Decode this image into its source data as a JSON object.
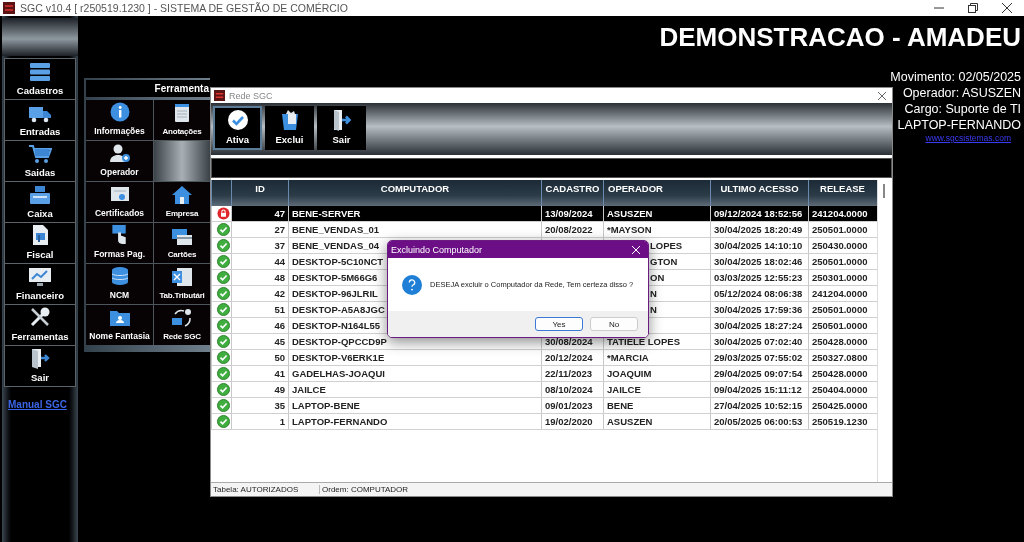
{
  "window": {
    "title": "SGC v10.4 [ r250519.1230 ] - SISTEMA DE GESTÃO DE COMÉRCIO"
  },
  "sidebar": {
    "items": [
      {
        "label": "Cadastros"
      },
      {
        "label": "Entradas"
      },
      {
        "label": "Saidas"
      },
      {
        "label": "Caixa"
      },
      {
        "label": "Fiscal"
      },
      {
        "label": "Financeiro"
      },
      {
        "label": "Ferramentas"
      },
      {
        "label": "Sair"
      }
    ],
    "link": "Manual SGC"
  },
  "header": {
    "title": "DEMONSTRACAO - AMADEU",
    "lines": [
      "Movimento: 02/05/2025",
      "Operador: ASUSZEN",
      "Cargo: Suporte de TI",
      "LAPTOP-FERNANDO"
    ],
    "link": "www.sgcsistemas.com"
  },
  "tools_panel": {
    "title": "Ferramenta",
    "items": [
      {
        "kind": "tool",
        "label": "Informações"
      },
      {
        "kind": "tool",
        "label": "Anotações"
      },
      {
        "kind": "tool",
        "label": "Operador"
      },
      {
        "kind": "blank"
      },
      {
        "kind": "tool",
        "label": "Certificados"
      },
      {
        "kind": "tool",
        "label": "Empresa"
      },
      {
        "kind": "tool",
        "label": "Formas Pag."
      },
      {
        "kind": "tool",
        "label": "Cartões"
      },
      {
        "kind": "tool",
        "label": "NCM"
      },
      {
        "kind": "tool",
        "label": "Tab.Tributári"
      },
      {
        "kind": "tool",
        "label": "Nome Fantasia"
      },
      {
        "kind": "tool",
        "label": "Rede SGC"
      }
    ]
  },
  "rede_window": {
    "title": "Rede SGC",
    "toolbar": [
      {
        "label": "Ativa",
        "selected": true
      },
      {
        "label": "Exclui",
        "selected": false
      },
      {
        "label": "Sair",
        "selected": false
      }
    ],
    "table": {
      "columns": [
        "ID",
        "COMPUTADOR",
        "CADASTRO",
        "OPERADOR",
        "ULTIMO ACESSO",
        "RELEASE"
      ],
      "rows": [
        {
          "locked": true,
          "selected": true,
          "covered": false,
          "id": "47",
          "computador": "BENE-SERVER",
          "cadastro": "13/09/2024",
          "operador": "ASUSZEN",
          "ultimo_acesso": "09/12/2024 18:52:56",
          "release": "241204.0000"
        },
        {
          "locked": false,
          "selected": false,
          "covered": false,
          "id": "27",
          "computador": "BENE_VENDAS_01",
          "cadastro": "20/08/2022",
          "operador": "*MAYSON",
          "ultimo_acesso": "30/04/2025 18:20:49",
          "release": "250501.0000"
        },
        {
          "locked": false,
          "selected": false,
          "covered": true,
          "id": "37",
          "computador": "BENE_VENDAS_04",
          "operador": "LOPES",
          "ultimo_acesso": "30/04/2025 14:10:10",
          "release": "250430.0000"
        },
        {
          "locked": false,
          "selected": false,
          "covered": true,
          "id": "44",
          "computador": "DESKTOP-5C10NCT",
          "operador": "GTON",
          "ultimo_acesso": "30/04/2025 18:02:46",
          "release": "250501.0000"
        },
        {
          "locked": false,
          "selected": false,
          "covered": true,
          "id": "48",
          "computador": "DESKTOP-5M66G6",
          "operador": "ON",
          "ultimo_acesso": "03/03/2025 12:55:23",
          "release": "250301.0000"
        },
        {
          "locked": false,
          "selected": false,
          "covered": true,
          "id": "42",
          "computador": "DESKTOP-96JLRIL",
          "operador": "N",
          "ultimo_acesso": "05/12/2024 08:06:38",
          "release": "241204.0000"
        },
        {
          "locked": false,
          "selected": false,
          "covered": true,
          "id": "51",
          "computador": "DESKTOP-A5A8JGC",
          "operador": "N",
          "ultimo_acesso": "30/04/2025 17:59:36",
          "release": "250501.0000"
        },
        {
          "locked": false,
          "selected": false,
          "id": "46",
          "computador": "DESKTOP-N164L55",
          "ultimo_acesso": "30/04/2025 18:27:24",
          "release": "250501.0000"
        },
        {
          "locked": false,
          "selected": false,
          "covered": false,
          "id": "45",
          "computador": "DESKTOP-QPCCD9P",
          "cadastro": "30/08/2024",
          "operador": "TATIELE LOPES",
          "ultimo_acesso": "30/04/2025 07:02:40",
          "release": "250428.0000"
        },
        {
          "locked": false,
          "selected": false,
          "covered": false,
          "id": "50",
          "computador": "DESKTOP-V6ERK1E",
          "cadastro": "20/12/2024",
          "operador": "*MARCIA",
          "ultimo_acesso": "29/03/2025 07:55:02",
          "release": "250327.0800"
        },
        {
          "locked": false,
          "selected": false,
          "covered": false,
          "id": "41",
          "computador": "GADELHAS-JOAQUI",
          "cadastro": "22/11/2023",
          "operador": "JOAQUIM",
          "ultimo_acesso": "29/04/2025 09:07:54",
          "release": "250428.0000"
        },
        {
          "locked": false,
          "selected": false,
          "covered": false,
          "id": "49",
          "computador": "JAILCE",
          "cadastro": "08/10/2024",
          "operador": "JAILCE",
          "ultimo_acesso": "09/04/2025 15:11:12",
          "release": "250404.0000"
        },
        {
          "locked": false,
          "selected": false,
          "covered": false,
          "id": "35",
          "computador": "LAPTOP-BENE",
          "cadastro": "09/01/2023",
          "operador": "BENE",
          "ultimo_acesso": "27/04/2025 10:52:15",
          "release": "250425.0000"
        },
        {
          "locked": false,
          "selected": false,
          "covered": false,
          "id": "1",
          "computador": "LAPTOP-FERNANDO",
          "cadastro": "19/02/2020",
          "operador": "ASUSZEN",
          "ultimo_acesso": "20/05/2025 06:00:53",
          "release": "250519.1230"
        }
      ]
    },
    "status_bar": [
      "Tabela: AUTORIZADOS",
      "Ordem: COMPUTADOR"
    ]
  },
  "dialog": {
    "title": "Excluindo Computador",
    "message": "DESEJA excluir o Computador da Rede, Tem certeza disso ?",
    "buttons": [
      {
        "label": "Yes",
        "selected": true
      },
      {
        "label": "No",
        "selected": false
      }
    ]
  }
}
